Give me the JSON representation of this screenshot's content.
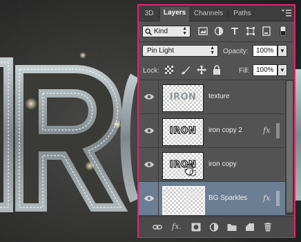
{
  "canvas": {
    "artwork_text": "IRON",
    "colors": {
      "bg_dark": "#2a2a2a",
      "metal": "#9aa3a8",
      "accent_glow": "#d9c58c"
    }
  },
  "panel": {
    "border_color": "#e3246f",
    "tabs": [
      {
        "label": "3D",
        "active": false
      },
      {
        "label": "Layers",
        "active": true
      },
      {
        "label": "Channels",
        "active": false
      },
      {
        "label": "Paths",
        "active": false
      }
    ],
    "menu_icon": "panel-menu-icon",
    "filter": {
      "kind_label": "Kind",
      "icons": [
        "image-filter-icon",
        "adjustment-filter-icon",
        "type-filter-icon",
        "shape-filter-icon",
        "smart-object-filter-icon",
        "filter-toggle-icon"
      ]
    },
    "blend": {
      "mode": "Pin Light",
      "opacity_label": "Opacity:",
      "opacity_value": "100%"
    },
    "lock": {
      "label": "Lock:",
      "icons": [
        "lock-transparency-icon",
        "lock-image-icon",
        "lock-position-icon",
        "lock-all-icon"
      ],
      "fill_label": "Fill:",
      "fill_value": "100%"
    },
    "layers": [
      {
        "name": "texture",
        "thumb_text": "IRON",
        "fx": "",
        "selected": false,
        "visible": true
      },
      {
        "name": "iron copy 2",
        "thumb_text": "IRON",
        "fx": "fx",
        "selected": false,
        "visible": true
      },
      {
        "name": "iron copy",
        "thumb_text": "IRON",
        "fx": "",
        "selected": false,
        "visible": true
      },
      {
        "name": "BG Sparkles",
        "thumb_text": "",
        "fx": "fx",
        "selected": true,
        "visible": true
      }
    ],
    "bottom_icons": [
      "link-layers-icon",
      "layer-style-icon",
      "layer-mask-icon",
      "adjustment-layer-icon",
      "new-group-icon",
      "new-layer-icon",
      "delete-layer-icon"
    ],
    "bottom_fx_label": "fx."
  }
}
